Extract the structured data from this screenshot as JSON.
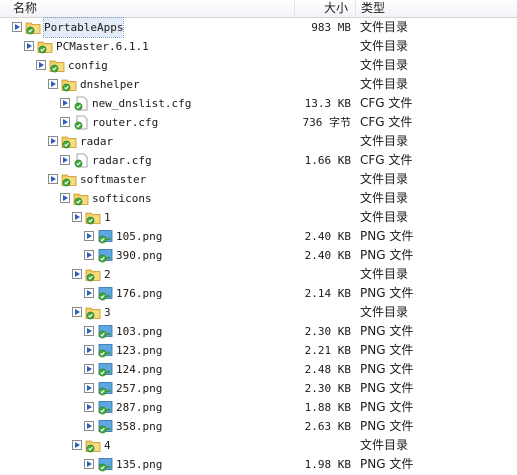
{
  "columns": {
    "name": "名称",
    "size": "大小",
    "type": "类型"
  },
  "colors": {
    "expander_arrow": "#2b5fbd",
    "folder": "#f0c34a",
    "check": "#3fa83a"
  },
  "rows": [
    {
      "name": "PortableApps",
      "size": "983 MB",
      "type": "文件目录",
      "kind": "folder",
      "depth": 0,
      "selected": true
    },
    {
      "name": "PCMaster.6.1.1",
      "size": "",
      "type": "文件目录",
      "kind": "folder",
      "depth": 1
    },
    {
      "name": "config",
      "size": "",
      "type": "文件目录",
      "kind": "folder",
      "depth": 2
    },
    {
      "name": "dnshelper",
      "size": "",
      "type": "文件目录",
      "kind": "folder",
      "depth": 3
    },
    {
      "name": "new_dnslist.cfg",
      "size": "13.3 KB",
      "type": "CFG 文件",
      "kind": "file",
      "depth": 4
    },
    {
      "name": "router.cfg",
      "size": "736 字节",
      "type": "CFG 文件",
      "kind": "file",
      "depth": 4
    },
    {
      "name": "radar",
      "size": "",
      "type": "文件目录",
      "kind": "folder",
      "depth": 3
    },
    {
      "name": "radar.cfg",
      "size": "1.66 KB",
      "type": "CFG 文件",
      "kind": "file",
      "depth": 4
    },
    {
      "name": "softmaster",
      "size": "",
      "type": "文件目录",
      "kind": "folder",
      "depth": 3
    },
    {
      "name": "softicons",
      "size": "",
      "type": "文件目录",
      "kind": "folder",
      "depth": 4
    },
    {
      "name": "1",
      "size": "",
      "type": "文件目录",
      "kind": "folder",
      "depth": 5
    },
    {
      "name": "105.png",
      "size": "2.40 KB",
      "type": "PNG 文件",
      "kind": "image",
      "depth": 6
    },
    {
      "name": "390.png",
      "size": "2.40 KB",
      "type": "PNG 文件",
      "kind": "image",
      "depth": 6
    },
    {
      "name": "2",
      "size": "",
      "type": "文件目录",
      "kind": "folder",
      "depth": 5
    },
    {
      "name": "176.png",
      "size": "2.14 KB",
      "type": "PNG 文件",
      "kind": "image",
      "depth": 6
    },
    {
      "name": "3",
      "size": "",
      "type": "文件目录",
      "kind": "folder",
      "depth": 5
    },
    {
      "name": "103.png",
      "size": "2.30 KB",
      "type": "PNG 文件",
      "kind": "image",
      "depth": 6
    },
    {
      "name": "123.png",
      "size": "2.21 KB",
      "type": "PNG 文件",
      "kind": "image",
      "depth": 6
    },
    {
      "name": "124.png",
      "size": "2.48 KB",
      "type": "PNG 文件",
      "kind": "image",
      "depth": 6
    },
    {
      "name": "257.png",
      "size": "2.30 KB",
      "type": "PNG 文件",
      "kind": "image",
      "depth": 6
    },
    {
      "name": "287.png",
      "size": "1.88 KB",
      "type": "PNG 文件",
      "kind": "image",
      "depth": 6
    },
    {
      "name": "358.png",
      "size": "2.63 KB",
      "type": "PNG 文件",
      "kind": "image",
      "depth": 6
    },
    {
      "name": "4",
      "size": "",
      "type": "文件目录",
      "kind": "folder",
      "depth": 5
    },
    {
      "name": "135.png",
      "size": "1.98 KB",
      "type": "PNG 文件",
      "kind": "image",
      "depth": 6
    }
  ]
}
